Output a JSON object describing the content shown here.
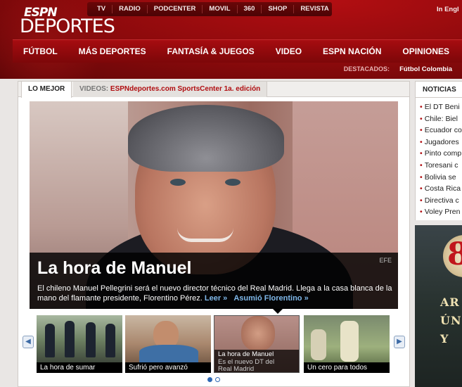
{
  "header": {
    "logo_espn": "ESPN",
    "logo_deportes": "DEPORTES",
    "top_nav": [
      "TV",
      "RADIO",
      "PODCENTER",
      "MOVIL",
      "360",
      "SHOP",
      "REVISTA"
    ],
    "language": "In Engl",
    "main_nav": [
      "FÚTBOL",
      "MÁS DEPORTES",
      "FANTASÍA & JUEGOS",
      "VIDEO",
      "ESPN NACIÓN",
      "OPINIONES"
    ],
    "destacados_label": "DESTACADOS:",
    "destacados_link": "Fútbol Colombia"
  },
  "tabs": {
    "active": "LO MEJOR",
    "videos_label": "VIDEOS:",
    "videos_link": "ESPNdeportes.com SportsCenter 1a. edición"
  },
  "hero": {
    "title": "La hora de Manuel",
    "credit": "EFE",
    "description": "El chileno Manuel Pellegrini será el nuevo director técnico del Real Madrid. Llega a la casa blanca de la mano del flamante presidente, Florentino Pérez.",
    "leer": "Leer »",
    "asumio": "Asumió Florentino »"
  },
  "carousel": {
    "prev": "◀",
    "next": "▶",
    "items": [
      {
        "caption": "La hora de sumar"
      },
      {
        "caption": "Sufrió pero avanzó"
      },
      {
        "caption": "La hora de Manuel",
        "sub1": "Es el nuevo DT del",
        "sub2": "Real Madrid"
      },
      {
        "caption": "Un cero para todos"
      }
    ]
  },
  "noticias": {
    "heading": "NOTICIAS",
    "items": [
      "El DT Beni",
      "Chile: Biel",
      "Ecuador co",
      "Jugadores",
      "Pinto comp",
      "Toresani c",
      "Bolivia se",
      "Costa Rica",
      "Directiva c",
      "Voley Pren"
    ]
  },
  "ad": {
    "number": "8",
    "line1": "AR",
    "line2": "ÚN",
    "line3": "Y"
  }
}
